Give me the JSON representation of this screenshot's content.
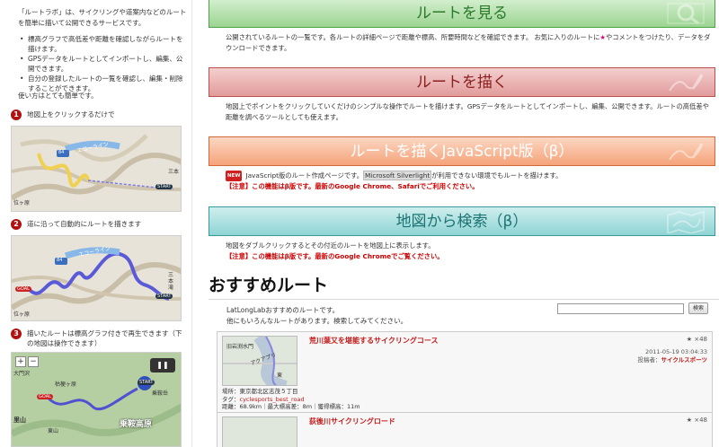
{
  "sidebar": {
    "intro": "「ルートラボ」は、サイクリングや道案内などのルートを簡単に描いて公開できるサービスです。",
    "bullets": [
      "標高グラフで高低差や距離を確認しながらルートを描けます。",
      "GPSデータをルートとしてインポートし、編集、公開できます。",
      "自分の登録したルートの一覧を確認し、編集・削除することができます。"
    ],
    "usage": "使い方はとても簡単です。",
    "steps": [
      {
        "num": "1",
        "text": "地図上をクリックするだけで"
      },
      {
        "num": "2",
        "text": "道に沿って自動的にルートを描きます"
      },
      {
        "num": "3",
        "text": "描いたルートは標高グラフ付きで再生できます（下の地図は操作できます）"
      }
    ],
    "map_labels": {
      "road1": "エコーライン",
      "road2": "エコーライン",
      "route_num": "84",
      "place1": "三本",
      "place2": "位ヶ原",
      "place3": "三本滝",
      "place4": "位ヶ原",
      "start": "START",
      "goal": "GOAL",
      "place5": "大門沢",
      "place6": "枯梗ヶ原",
      "place7": "乗鞍岳",
      "place8": "東山",
      "place9": "乗鞍高原",
      "place10": "里山",
      "zoom_in": "+",
      "zoom_out": "−"
    }
  },
  "buttons": {
    "view": "ルートを見る",
    "draw": "ルートを描く",
    "draw_js": "ルートを描くJavaScript版（β）",
    "search_map": "地図から検索（β）"
  },
  "descs": {
    "view": "公開されているルートの一覧です。各ルートの詳細ページで距離や標高、所要時間などを確認できます。 お気に入りのルートに",
    "view_star": "★",
    "view_tail": "やコメントをつけたり、データをダウンロードできます。",
    "draw": "地図上でポイントをクリックしていくだけのシンプルな操作でルートを描けます。GPSデータをルートとしてインポートし、編集、公開できます。ルートの高低差や距離を調べるツールとしても使えます。",
    "js_new": "NEW",
    "js_pre": "JavaScript版のルート作成ページです。",
    "js_hl": "Microsoft Silverlight",
    "js_post": "が利用できない環境でもルートを描けます。",
    "js_warn": "【注意】この機能はβ版です。最新のGoogle Chrome、Safariでご利用ください。",
    "search": "地図をダブルクリックするとその付近のルートを地図上に表示します。",
    "search_warn": "【注意】この機能はβ版です。最新のGoogle Chromeでご覧ください。"
  },
  "recommend": {
    "heading": "おすすめルート",
    "intro1": "LatLongLabおすすめのルートです。",
    "intro2": "他にもいろんなルートがあります。検索してみてください。",
    "search_placeholder": "",
    "search_button": "検索",
    "cards": [
      {
        "title": "荒川葉又を堪能するサイクリングコース",
        "fav": "★ ×48",
        "date": "2011-05-19 03:04:33",
        "author_label": "投稿者：",
        "author": "サイクルスポーツ",
        "place": "場所：東京都北区志茂５丁目",
        "tag_label": "タグ：",
        "tag": "cyclesports_best_road",
        "stats": "距離：68.9km｜最大標高差：8m｜獲得標高：11m",
        "thumb_text1": "旧岩渕水門",
        "thumb_text2": "アクアプリ",
        "thumb_text3": "東"
      },
      {
        "title": "荻後川サイクリングロード",
        "fav": "★ ×48"
      }
    ]
  }
}
